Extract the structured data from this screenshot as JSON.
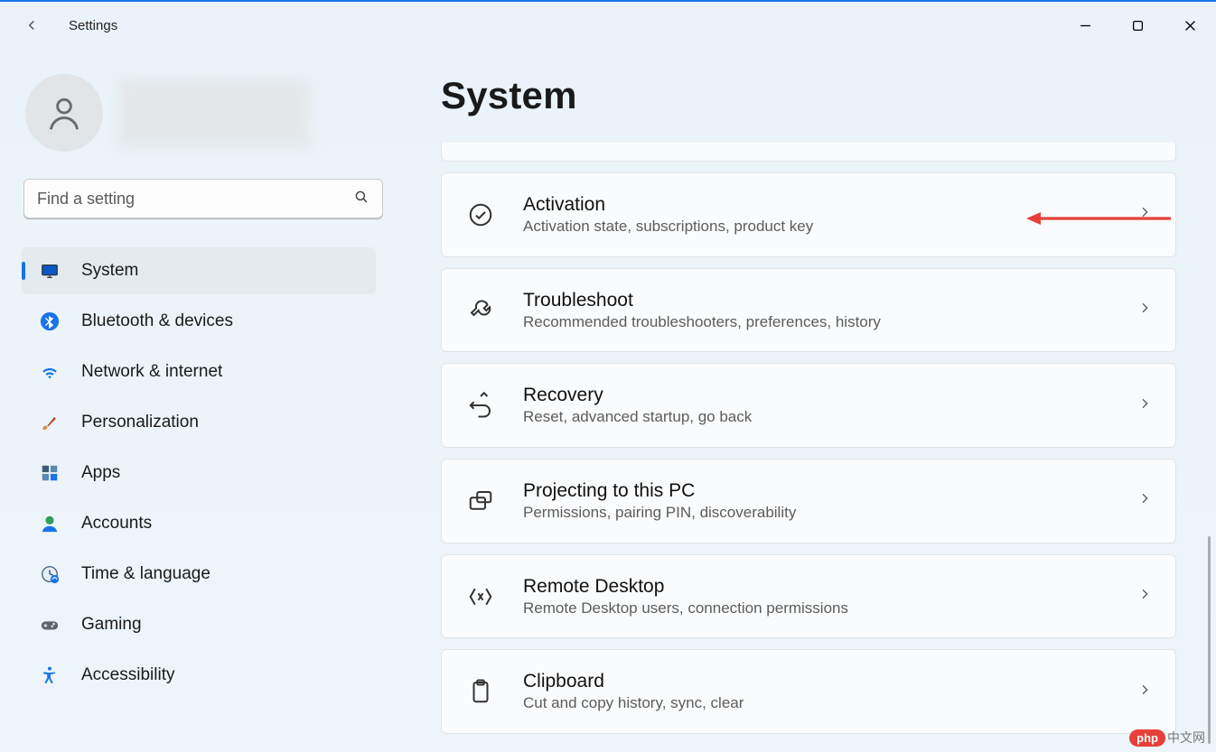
{
  "title_bar": {
    "app_title": "Settings"
  },
  "search": {
    "placeholder": "Find a setting"
  },
  "sidebar": {
    "items": [
      {
        "icon": "monitor-icon",
        "label": "System",
        "active": true
      },
      {
        "icon": "bluetooth-icon",
        "label": "Bluetooth & devices",
        "active": false
      },
      {
        "icon": "wifi-icon",
        "label": "Network & internet",
        "active": false
      },
      {
        "icon": "brush-icon",
        "label": "Personalization",
        "active": false
      },
      {
        "icon": "apps-icon",
        "label": "Apps",
        "active": false
      },
      {
        "icon": "accounts-icon",
        "label": "Accounts",
        "active": false
      },
      {
        "icon": "time-icon",
        "label": "Time & language",
        "active": false
      },
      {
        "icon": "gaming-icon",
        "label": "Gaming",
        "active": false
      },
      {
        "icon": "accessibility-icon",
        "label": "Accessibility",
        "active": false
      }
    ]
  },
  "main": {
    "heading": "System",
    "cards": [
      {
        "icon": "check-circle-icon",
        "title": "Activation",
        "desc": "Activation state, subscriptions, product key"
      },
      {
        "icon": "wrench-icon",
        "title": "Troubleshoot",
        "desc": "Recommended troubleshooters, preferences, history"
      },
      {
        "icon": "recovery-icon",
        "title": "Recovery",
        "desc": "Reset, advanced startup, go back"
      },
      {
        "icon": "projecting-icon",
        "title": "Projecting to this PC",
        "desc": "Permissions, pairing PIN, discoverability"
      },
      {
        "icon": "remote-desktop-icon",
        "title": "Remote Desktop",
        "desc": "Remote Desktop users, connection permissions"
      },
      {
        "icon": "clipboard-icon",
        "title": "Clipboard",
        "desc": "Cut and copy history, sync, clear"
      }
    ]
  },
  "watermark": {
    "badge": "php",
    "text": "中文网"
  },
  "colors": {
    "accent": "#1a73e8",
    "arrow": "#e6403b"
  }
}
